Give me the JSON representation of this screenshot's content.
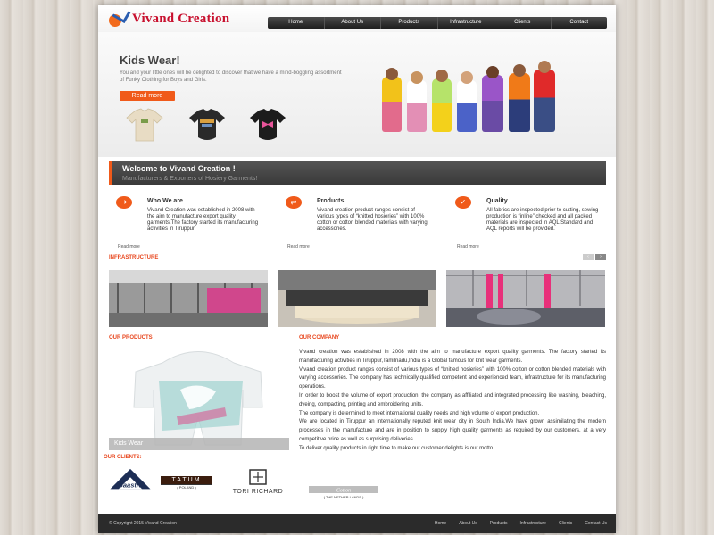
{
  "logo": {
    "text": "Vivand Creation"
  },
  "nav": [
    "Home",
    "About Us",
    "Products",
    "Infrastructure",
    "Clients",
    "Contact"
  ],
  "hero": {
    "title": "Kids Wear!",
    "text": "You and your little ones will be delighted to discover that we have a mind-boggling assortment of Funky Clothing for Boys and Girls.",
    "button": "Read more",
    "arrow": "→"
  },
  "welcome": {
    "title": "Welcome to Vivand Creation !",
    "subtitle": "Manufacturers & Exporters of Hosiery Garments!"
  },
  "features": [
    {
      "icon": "➜",
      "title": "Who We are",
      "text": "Vivand Creation was established in 2008 with the aim to manufacture export quality garments.The factory started its manufacturing activities in Tiruppur.",
      "more": "Read more"
    },
    {
      "icon": "⇄",
      "title": "Products",
      "text": "Vivand creation product ranges consist of various types of “knitted hosieries” with 100% cotton or cotton blended materials with varying accessories.",
      "more": "Read more"
    },
    {
      "icon": "✓",
      "title": "Quality",
      "text": "All fabrics are inspected prior to cutting, sewing production is “inline” checked and all packed materials are inspected in AQL Standard and AQL reports will be provided.",
      "more": "Read more"
    }
  ],
  "infrastructure": {
    "label": "Infrastructure",
    "prev": "‹",
    "next": "›"
  },
  "products": {
    "label": "Our Products",
    "caption": "Kids Wear"
  },
  "company": {
    "label": "Our Company",
    "paragraphs": [
      "Vivand creation was established in 2008 with the aim to manufacture export quality garments. The factory started its manufacturing activities in Tiruppur,Tamilnadu,India is a Global famous for knit wear garments.",
      "Vivand creation product ranges consist of various types of “knitted hosieries” with 100% cotton or cotton blended materials with varying accessories. The company has technically qualified competent and experienced team, infrastructure for its manufacturing operations.",
      "In order to boost the volume of export production, the company as affiliated and integrated processing like washing, bleaching, dyeing, compacting, printing and embroidering units.",
      "The company is determined to meet international quality needs and high volume of export production.",
      "We are located in Tiruppur an internationally reputed knit wear city in South India.We have grown assimilating the modern processes in the manufacture and are in position to supply high quality garments as required by our customers, at a very competitive price as well as surprising deliveries",
      "To deliver quality products in right time to make our customer delights is our motto."
    ]
  },
  "clients": {
    "label": "Our Clients:",
    "items": [
      {
        "name": "Gaastra"
      },
      {
        "name": "TATUM",
        "sub": "( POLAND )"
      },
      {
        "name": "TORI RICHARD"
      },
      {
        "name": "Cotton",
        "sub": "( THE NETHER LANDS )"
      }
    ]
  },
  "footer": {
    "copyright": "© Copyright 2015 Vivand Creation",
    "links": [
      "Home",
      "About Us",
      "Products",
      "Infrastructure",
      "Clients",
      "Contact Us"
    ]
  },
  "colors": {
    "accent": "#f05a1a",
    "brand": "#c8102e",
    "dark": "#2b2b2b"
  }
}
